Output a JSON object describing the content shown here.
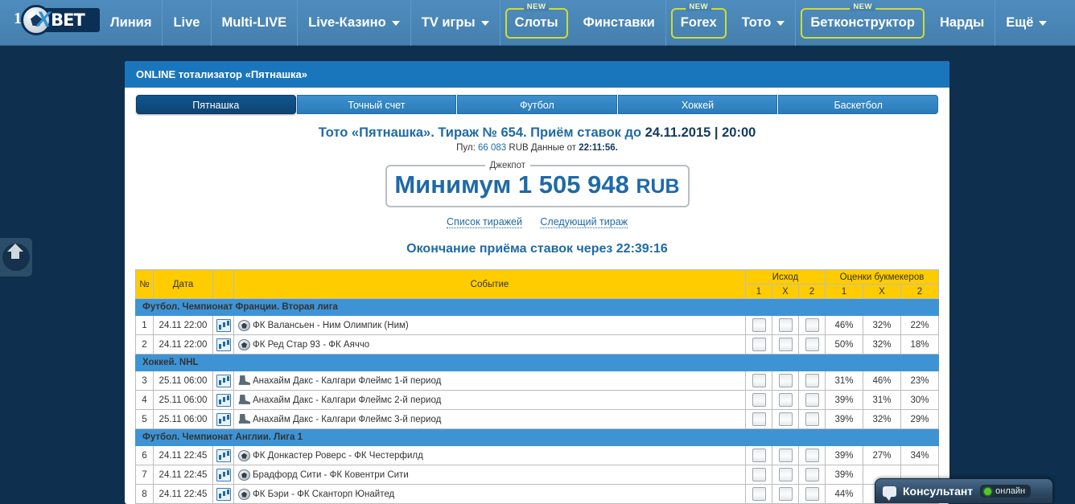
{
  "brand": {
    "logo_one": "1",
    "logo_x": "X",
    "logo_text": "BET"
  },
  "nav": [
    {
      "label": "Линия",
      "boxed": false,
      "caret": false,
      "new": false
    },
    {
      "label": "Live",
      "boxed": false,
      "caret": false,
      "new": false
    },
    {
      "label": "Multi-LIVE",
      "boxed": false,
      "caret": false,
      "new": false
    },
    {
      "label": "Live-Казино",
      "boxed": false,
      "caret": true,
      "new": false
    },
    {
      "label": "TV игры",
      "boxed": false,
      "caret": true,
      "new": false
    },
    {
      "label": "Слоты",
      "boxed": true,
      "caret": false,
      "new": true,
      "new_label": "NEW"
    },
    {
      "label": "Финставки",
      "boxed": false,
      "caret": false,
      "new": false
    },
    {
      "label": "Forex",
      "boxed": true,
      "caret": false,
      "new": true,
      "new_label": "NEW"
    },
    {
      "label": "Тото",
      "boxed": false,
      "caret": true,
      "new": false
    },
    {
      "label": "Бетконструктор",
      "boxed": true,
      "caret": false,
      "new": true,
      "new_label": "NEW"
    },
    {
      "label": "Нарды",
      "boxed": false,
      "caret": false,
      "new": false
    },
    {
      "label": "Ещё",
      "boxed": false,
      "caret": true,
      "new": false
    }
  ],
  "panel": {
    "title": "ONLINE тотализатор «Пятнашка»"
  },
  "tabs": [
    {
      "label": "Пятнашка",
      "active": true
    },
    {
      "label": "Точный счет",
      "active": false
    },
    {
      "label": "Футбол",
      "active": false
    },
    {
      "label": "Хоккей",
      "active": false
    },
    {
      "label": "Баскетбол",
      "active": false
    }
  ],
  "draw": {
    "heading_prefix": "Тото «Пятнашка». Тираж № 654. Приём ставок до ",
    "heading_date": "24.11.2015 | 20:00",
    "pool_label": "Пул: ",
    "pool_value": "66 083",
    "pool_currency": " RUB",
    "data_label": " Данные от ",
    "data_time": "22:11:56.",
    "jackpot_legend": "Джекпот",
    "jackpot_text": "Минимум 1 505 948 ",
    "jackpot_currency": "RUB",
    "link_list": "Список тиражей",
    "link_next": "Следующий тираж",
    "countdown_label": "Окончание приёма ставок через ",
    "countdown_value": "22:39:16"
  },
  "table": {
    "headers": {
      "num": "№",
      "date": "Дата",
      "icon": "",
      "event": "Событие",
      "outcome_group": "Исход",
      "odds_group": "Оценки букмекеров",
      "sub": [
        "1",
        "X",
        "2",
        "1",
        "X",
        "2"
      ]
    },
    "groups": [
      {
        "title": "Футбол. Чемпионат Франции. Вторая лига",
        "sport": "ball",
        "rows": [
          {
            "num": "1",
            "date": "24.11 22:00",
            "event": "ФК Валансьен - Ним Олимпик (Ним)",
            "p1": "46%",
            "px": "32%",
            "p2": "22%"
          },
          {
            "num": "2",
            "date": "24.11 22:00",
            "event": "ФК Ред Стар 93 - ФК Аяччо",
            "p1": "50%",
            "px": "32%",
            "p2": "18%"
          }
        ]
      },
      {
        "title": "Хоккей. NHL",
        "sport": "skate",
        "rows": [
          {
            "num": "3",
            "date": "25.11 06:00",
            "event": "Анахайм Дакс - Калгари Флеймс 1-й период",
            "p1": "31%",
            "px": "46%",
            "p2": "23%"
          },
          {
            "num": "4",
            "date": "25.11 06:00",
            "event": "Анахайм Дакс - Калгари Флеймс 2-й период",
            "p1": "39%",
            "px": "31%",
            "p2": "30%"
          },
          {
            "num": "5",
            "date": "25.11 06:00",
            "event": "Анахайм Дакс - Калгари Флеймс 3-й период",
            "p1": "39%",
            "px": "32%",
            "p2": "29%"
          }
        ]
      },
      {
        "title": "Футбол. Чемпионат Англии. Лига 1",
        "sport": "ball",
        "rows": [
          {
            "num": "6",
            "date": "24.11 22:45",
            "event": "ФК Донкастер Роверс - ФК Честерфилд",
            "p1": "39%",
            "px": "27%",
            "p2": "34%"
          },
          {
            "num": "7",
            "date": "24.11 22:45",
            "event": "Брадфорд Сити - ФК Ковентри Сити",
            "p1": "39%",
            "px": "",
            "p2": ""
          },
          {
            "num": "8",
            "date": "24.11 22:45",
            "event": "ФК Бэри - ФК Сканторп Юнайтед",
            "p1": "44%",
            "px": "",
            "p2": ""
          }
        ]
      }
    ]
  },
  "chat": {
    "label": "Консультант",
    "status": "онлайн"
  },
  "colors": {
    "page_bg": "#0e2f4d",
    "header_blue": "#4a86b6",
    "accent_yellow": "#ffcc00",
    "group_blue": "#3e93d4",
    "link_blue": "#1e6aa8",
    "new_border": "#cddc39",
    "online_green": "#4fcc22"
  }
}
